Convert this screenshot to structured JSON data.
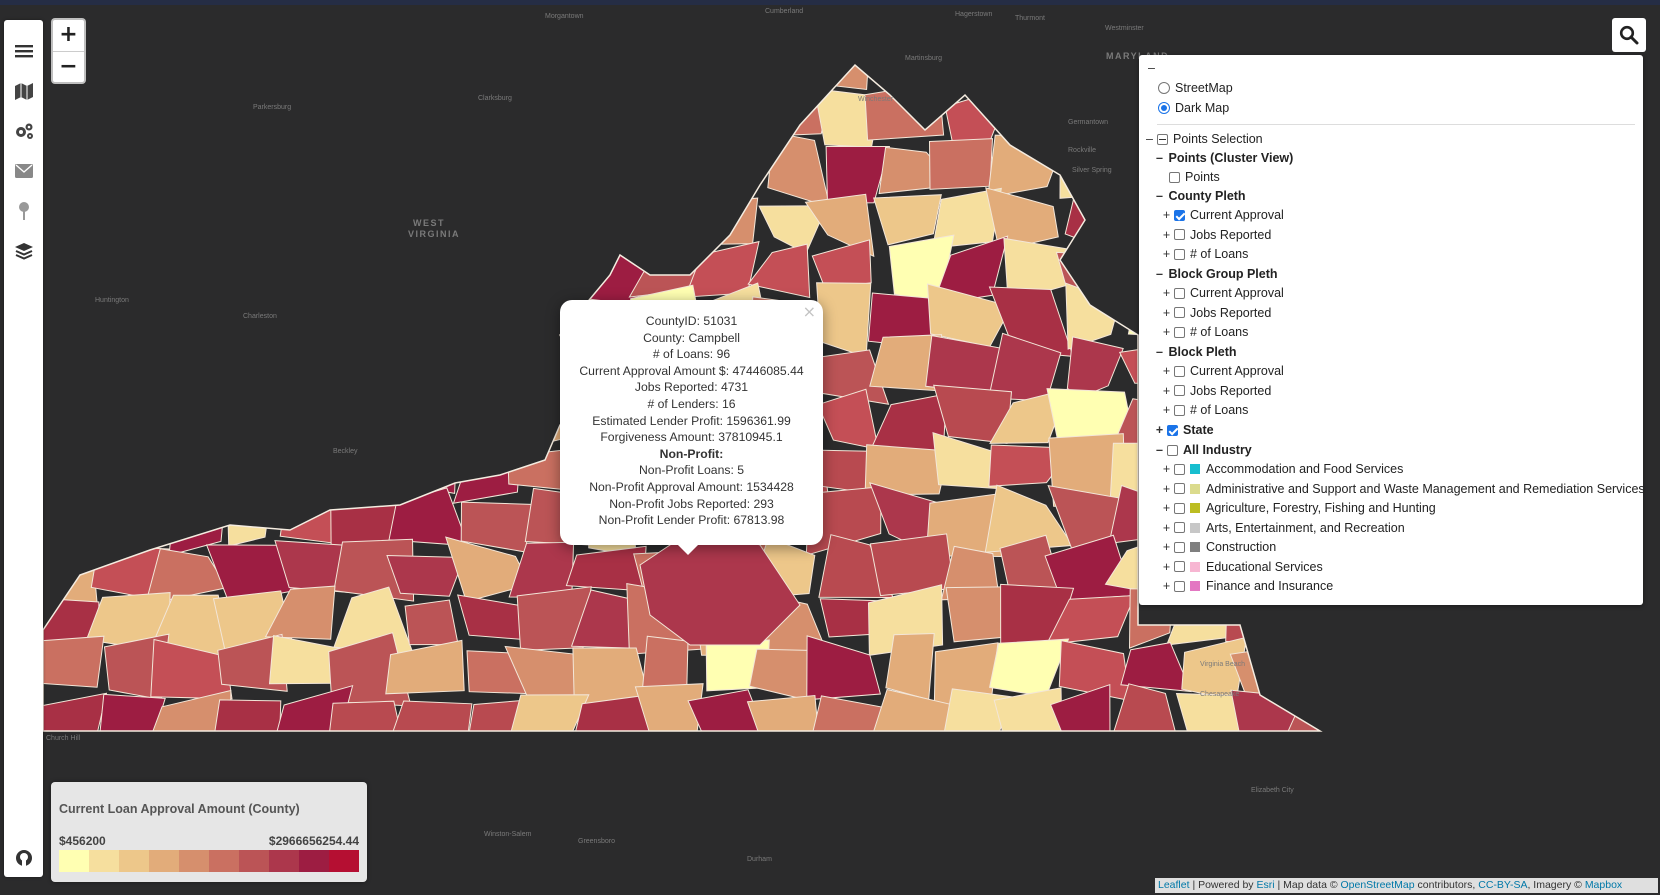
{
  "map": {
    "place_labels": [
      {
        "text": "Morgantown"
      },
      {
        "text": "Cumberland"
      },
      {
        "text": "Hagerstown"
      },
      {
        "text": "Thurmont"
      },
      {
        "text": "Westminster"
      },
      {
        "text": "WEST"
      },
      {
        "text": "VIRGINIA"
      },
      {
        "text": "MARYLAND"
      },
      {
        "text": "Charleston"
      },
      {
        "text": "Huntington"
      },
      {
        "text": "Winchester"
      },
      {
        "text": "Martinsburg"
      },
      {
        "text": "Germantown"
      },
      {
        "text": "Rockville"
      },
      {
        "text": "Silver Spring"
      },
      {
        "text": "Virginia Beach"
      },
      {
        "text": "Chesapeake"
      },
      {
        "text": "Winston-Salem"
      },
      {
        "text": "Greensboro"
      },
      {
        "text": "Durham"
      },
      {
        "text": "Church Hill"
      },
      {
        "text": "Elizabeth City"
      },
      {
        "text": "Clarksburg"
      },
      {
        "text": "Parkersburg"
      },
      {
        "text": "Beckley"
      }
    ],
    "region_colors": [
      "#ffffb2",
      "#f6df9e",
      "#edc78a",
      "#e2ac7a",
      "#d68f6d",
      "#ca7061",
      "#bb5456",
      "#ac374c",
      "#9d1d42",
      "#c44f56",
      "#a83045",
      "#b84a50"
    ]
  },
  "sidebar": {
    "icons": [
      "menu-icon",
      "map-icon",
      "gears-icon",
      "envelope-icon",
      "pin-icon",
      "layers-icon",
      "github-icon"
    ]
  },
  "zoom": {
    "in_label": "+",
    "out_label": "−"
  },
  "layers_panel": {
    "collapse_symbol": "–",
    "basemaps": [
      {
        "label": "StreetMap",
        "selected": false
      },
      {
        "label": "Dark Map",
        "selected": true
      }
    ],
    "points_selection": "Points Selection",
    "points_cluster": "Points (Cluster View)",
    "points": "Points",
    "county_pleth": "County Pleth",
    "county_items": [
      {
        "label": "Current Approval",
        "checked": true
      },
      {
        "label": "Jobs Reported",
        "checked": false
      },
      {
        "label": "# of Loans",
        "checked": false
      }
    ],
    "block_group_pleth": "Block Group Pleth",
    "block_group_items": [
      {
        "label": "Current Approval",
        "checked": false
      },
      {
        "label": "Jobs Reported",
        "checked": false
      },
      {
        "label": "# of Loans",
        "checked": false
      }
    ],
    "block_pleth": "Block Pleth",
    "block_items": [
      {
        "label": "Current Approval",
        "checked": false
      },
      {
        "label": "Jobs Reported",
        "checked": false
      },
      {
        "label": "# of Loans",
        "checked": false
      }
    ],
    "state": "State",
    "all_industry": "All Industry",
    "industries": [
      {
        "label": "Accommodation and Food Services",
        "color": "#17becf"
      },
      {
        "label": "Administrative and Support and Waste Management and Remediation Services",
        "color": "#dbdb8d"
      },
      {
        "label": "Agriculture, Forestry, Fishing and Hunting",
        "color": "#bcbd22"
      },
      {
        "label": "Arts, Entertainment, and Recreation",
        "color": "#c7c7c7"
      },
      {
        "label": "Construction",
        "color": "#7f7f7f"
      },
      {
        "label": "Educational Services",
        "color": "#f7b6d2"
      },
      {
        "label": "Finance and Insurance",
        "color": "#e377c2"
      }
    ]
  },
  "popup": {
    "close": "×",
    "lines": [
      {
        "text": "CountyID: 51031",
        "bold": false
      },
      {
        "text": "County: Campbell",
        "bold": false
      },
      {
        "text": "# of Loans: 96",
        "bold": false
      },
      {
        "text": "Current Approval Amount $: 47446085.44",
        "bold": false
      },
      {
        "text": "Jobs Reported: 4731",
        "bold": false
      },
      {
        "text": "# of Lenders: 16",
        "bold": false
      },
      {
        "text": "Estimated Lender Profit: 1596361.99",
        "bold": false
      },
      {
        "text": "Forgiveness Amount: 37810945.1",
        "bold": false
      },
      {
        "text": "Non-Profit:",
        "bold": true
      },
      {
        "text": "Non-Profit Loans: 5",
        "bold": false
      },
      {
        "text": "Non-Profit Approval Amount: 1534428",
        "bold": false
      },
      {
        "text": "Non-Profit Jobs Reported: 293",
        "bold": false
      },
      {
        "text": "Non-Profit Lender Profit: 67813.98",
        "bold": false
      }
    ]
  },
  "legend": {
    "title": "Current Loan Approval Amount (County)",
    "min": "$456200",
    "max": "$2966656254.44",
    "colors": [
      "#ffffb2",
      "#f6df9e",
      "#edc78a",
      "#e2ac7a",
      "#d68f6d",
      "#ca7061",
      "#bb5456",
      "#ac374c",
      "#9d1d42",
      "#b50f32"
    ]
  },
  "attribution": {
    "leaflet": "Leaflet",
    "sep1": " | Powered by ",
    "esri": "Esri",
    "sep2": " | Map data © ",
    "osm": "OpenStreetMap",
    "sep3": " contributors, ",
    "ccbysa": "CC-BY-SA",
    "sep4": ", Imagery © ",
    "mapbox": "Mapbox"
  }
}
